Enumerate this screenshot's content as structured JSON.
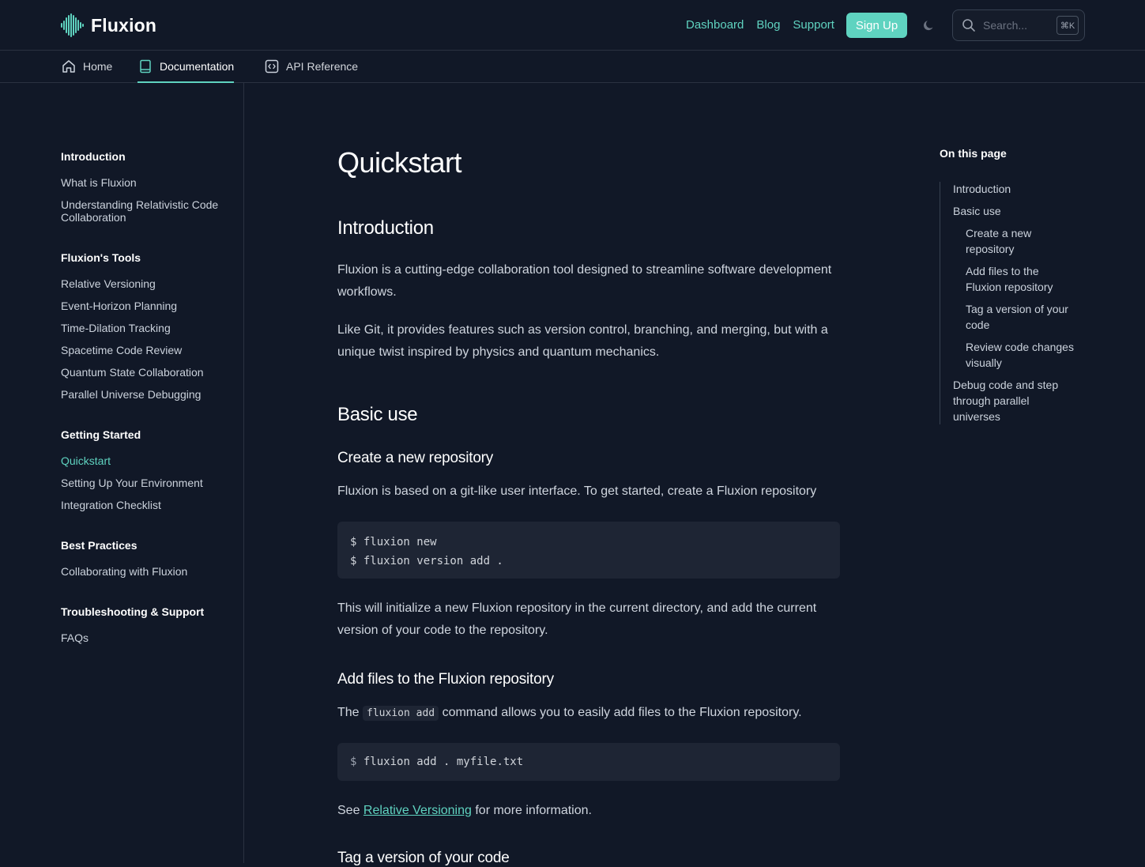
{
  "header": {
    "brand": "Fluxion",
    "nav": [
      "Dashboard",
      "Blog",
      "Support"
    ],
    "signup_label": "Sign Up",
    "search_placeholder": "Search...",
    "search_shortcut": "⌘K",
    "accent_color": "#5fd3c0"
  },
  "tabs": [
    {
      "label": "Home",
      "icon": "home-icon"
    },
    {
      "label": "Documentation",
      "icon": "book-icon",
      "active": true
    },
    {
      "label": "API Reference",
      "icon": "code-icon"
    }
  ],
  "sidebar": {
    "sections": [
      {
        "title": "Introduction",
        "items": [
          "What is Fluxion",
          "Understanding Relativistic Code Collaboration"
        ]
      },
      {
        "title": "Fluxion's Tools",
        "items": [
          "Relative Versioning",
          "Event-Horizon Planning",
          "Time-Dilation Tracking",
          "Spacetime Code Review",
          "Quantum State Collaboration",
          "Parallel Universe Debugging"
        ]
      },
      {
        "title": "Getting Started",
        "items": [
          "Quickstart",
          "Setting Up Your Environment",
          "Integration Checklist"
        ],
        "active_item": "Quickstart"
      },
      {
        "title": "Best Practices",
        "items": [
          "Collaborating with Fluxion"
        ]
      },
      {
        "title": "Troubleshooting & Support",
        "items": [
          "FAQs"
        ]
      }
    ]
  },
  "main": {
    "title": "Quickstart",
    "intro_heading": "Introduction",
    "intro_p1": "Fluxion is a cutting-edge collaboration tool designed to streamline software development workflows.",
    "intro_p2": "Like Git, it provides features such as version control, branching, and merging, but with a unique twist inspired by physics and quantum mechanics.",
    "basic_heading": "Basic use",
    "create_heading": "Create a new repository",
    "create_p": "Fluxion is based on a git-like user interface. To get started, create a Fluxion repository",
    "create_code_1": "$ fluxion new",
    "create_code_2": "$ fluxion version add .",
    "create_p2": "This will initialize a new Fluxion repository in the current directory, and add the current version of your code to the repository.",
    "add_heading": "Add files to the Fluxion repository",
    "add_p_before": "The",
    "add_p_code": "fluxion add",
    "add_p_after": "command allows you to easily add files to the Fluxion repository.",
    "add_code_prompt": "$",
    "add_code_cmd": "fluxion add . myfile.txt",
    "see_before": "See",
    "see_link": "Relative Versioning",
    "see_after": "for more information.",
    "tag_heading": "Tag a version of your code"
  },
  "toc": {
    "title": "On this page",
    "items": [
      "Introduction",
      "Basic use",
      "Create a new repository",
      "Add files to the Fluxion repository",
      "Tag a version of your code",
      "Review code changes visually",
      "Debug code and step through parallel universes"
    ]
  }
}
